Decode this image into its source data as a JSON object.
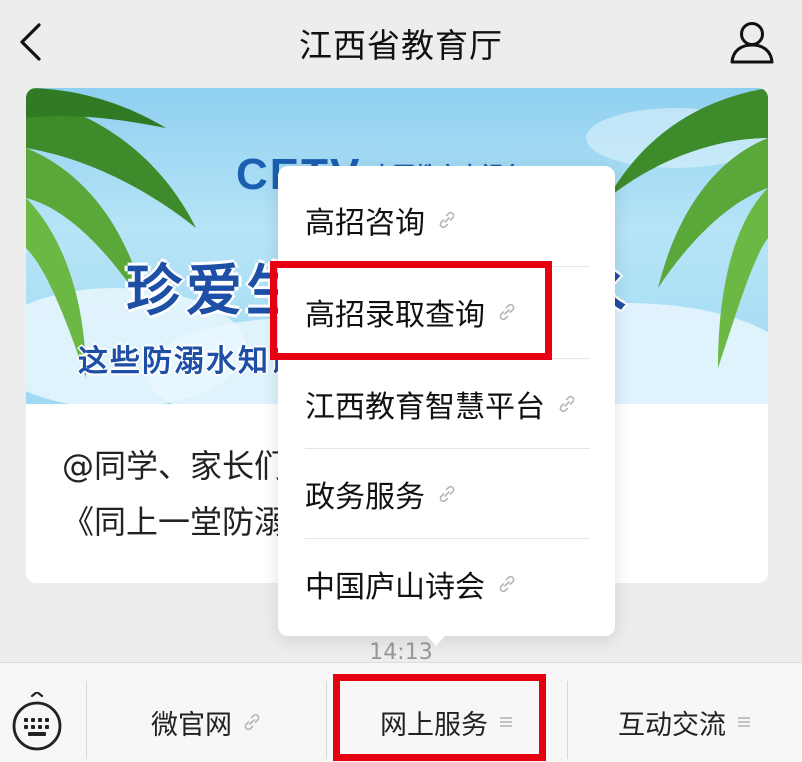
{
  "header": {
    "title": "江西省教育厅",
    "back_icon": "chevron-left-icon",
    "profile_icon": "person-icon"
  },
  "article": {
    "banner": {
      "logo_text": "CETV",
      "logo_sub": "中国教育电视台",
      "headline": "珍爱生命 预防溺水",
      "subline": "这些防溺水知识一起来看！"
    },
    "text_line1": "@同学、家长们，江西省教育厅提醒你",
    "text_line2": "《同上一堂防溺水安全课》"
  },
  "timestamp": "14:13",
  "popup_menu": {
    "items": [
      {
        "label": "高招咨询",
        "icon": "link-icon"
      },
      {
        "label": "高招录取查询",
        "icon": "link-icon"
      },
      {
        "label": "江西教育智慧平台",
        "icon": "link-icon"
      },
      {
        "label": "政务服务",
        "icon": "link-icon"
      },
      {
        "label": "中国庐山诗会",
        "icon": "link-icon"
      }
    ]
  },
  "bottom_bar": {
    "keyboard_icon": "keyboard-icon",
    "tabs": [
      {
        "label": "微官网",
        "icon": "link-icon"
      },
      {
        "label": "网上服务",
        "icon": "menu-lines-icon"
      },
      {
        "label": "互动交流",
        "icon": "menu-lines-icon"
      }
    ]
  },
  "colors": {
    "highlight": "#e60012",
    "background": "#ededed"
  }
}
